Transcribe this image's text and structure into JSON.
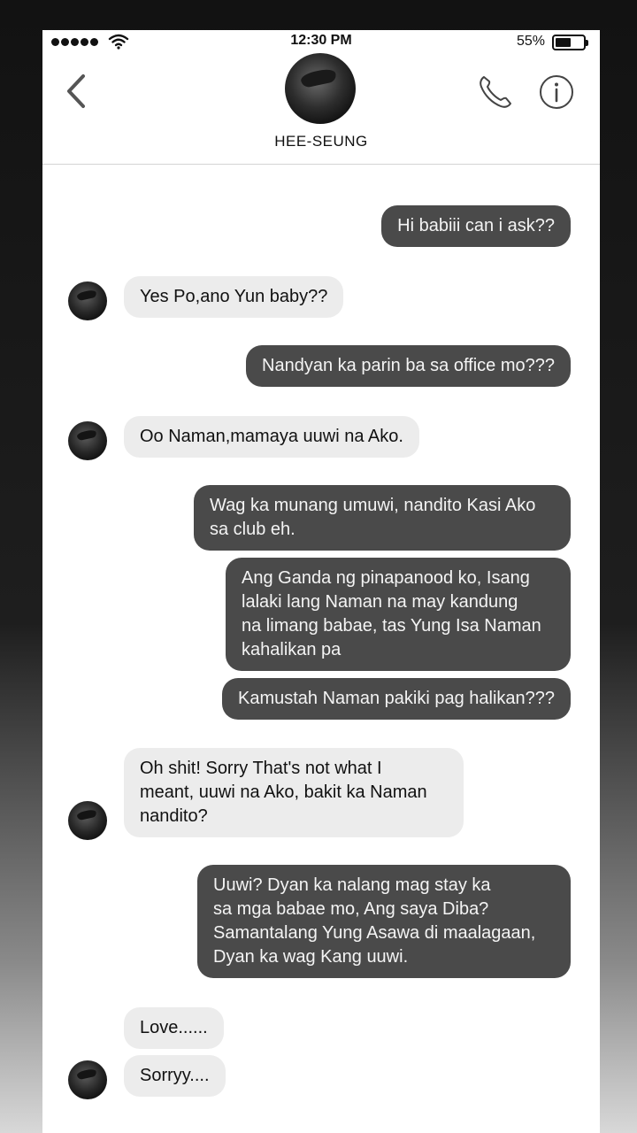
{
  "status_bar": {
    "time": "12:30 PM",
    "battery_percent": "55%",
    "battery_level": 0.55,
    "signal_icon": "signal-dots-icon",
    "wifi_icon": "wifi-icon"
  },
  "header": {
    "contact_name": "HEE-SEUNG",
    "back_icon": "chevron-left-icon",
    "call_icon": "phone-icon",
    "info_icon": "info-icon"
  },
  "colors": {
    "sent_bubble": "#4a4a4a",
    "received_bubble": "#ececec",
    "background": "#ffffff"
  },
  "messages": [
    {
      "sender": "me",
      "text": "Hi babiii can i ask??"
    },
    {
      "sender": "contact",
      "text": "Yes Po,ano Yun baby??"
    },
    {
      "sender": "me",
      "text": "Nandyan ka parin ba sa office mo???"
    },
    {
      "sender": "contact",
      "text": "Oo Naman,mamaya uuwi na Ako."
    },
    {
      "sender": "me",
      "text": "Wag ka munang umuwi, nandito Kasi Ako\nsa club eh."
    },
    {
      "sender": "me",
      "text": "Ang Ganda ng pinapanood ko, Isang\nlalaki lang Naman na may  kandung\nna limang babae, tas Yung Isa Naman\nkahalikan pa"
    },
    {
      "sender": "me",
      "text": "Kamustah Naman pakiki pag halikan???"
    },
    {
      "sender": "contact",
      "text": "Oh shit! Sorry That's not what I\nmeant, uuwi na Ako, bakit ka Naman\nnandito?"
    },
    {
      "sender": "me",
      "text": "Uuwi? Dyan ka nalang mag stay ka\nsa mga babae mo, Ang saya Diba?\nSamantalang Yung Asawa di maalagaan,\nDyan ka wag Kang uuwi."
    },
    {
      "sender": "contact",
      "text": "Love......"
    },
    {
      "sender": "contact",
      "text": "Sorryy...."
    }
  ]
}
